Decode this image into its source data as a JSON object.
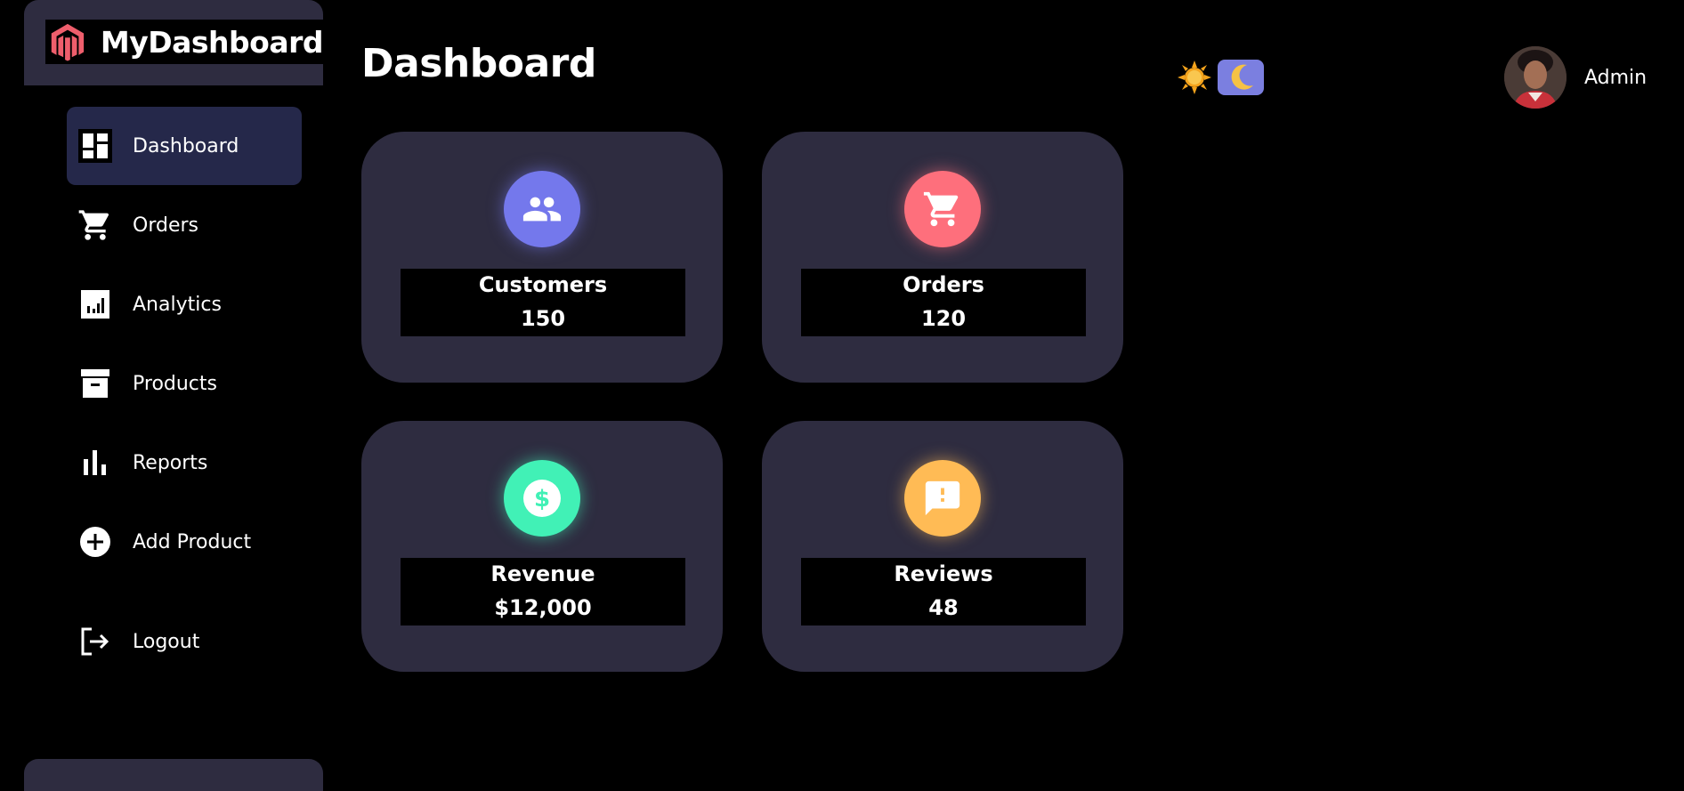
{
  "brand": {
    "name": "MyDashboard",
    "logo_icon": "magento-logo-icon",
    "logo_color": "#ee5e6c"
  },
  "sidebar": {
    "items": [
      {
        "label": "Dashboard",
        "icon": "dashboard-icon",
        "active": true
      },
      {
        "label": "Orders",
        "icon": "cart-icon",
        "active": false
      },
      {
        "label": "Analytics",
        "icon": "analytics-icon",
        "active": false
      },
      {
        "label": "Products",
        "icon": "archive-icon",
        "active": false
      },
      {
        "label": "Reports",
        "icon": "bar-chart-icon",
        "active": false
      },
      {
        "label": "Add Product",
        "icon": "add-circle-icon",
        "active": false
      }
    ],
    "logout_label": "Logout"
  },
  "header": {
    "title": "Dashboard",
    "theme_toggle": {
      "light_icon": "sun-icon",
      "dark_icon": "moon-icon"
    },
    "user": {
      "name": "Admin",
      "avatar": "avatar"
    }
  },
  "cards": [
    {
      "label": "Customers",
      "value": "150",
      "icon": "people-icon",
      "color": "#7478ec"
    },
    {
      "label": "Orders",
      "value": "120",
      "icon": "cart-icon",
      "color": "#fe6f7c"
    },
    {
      "label": "Revenue",
      "value": "$12,000",
      "icon": "dollar-icon",
      "color": "#41f1b6"
    },
    {
      "label": "Reviews",
      "value": "48",
      "icon": "feedback-icon",
      "color": "#ffbb55"
    }
  ],
  "colors": {
    "panel": "#2e2c40",
    "active_nav": "#25284a",
    "background": "#000000"
  }
}
